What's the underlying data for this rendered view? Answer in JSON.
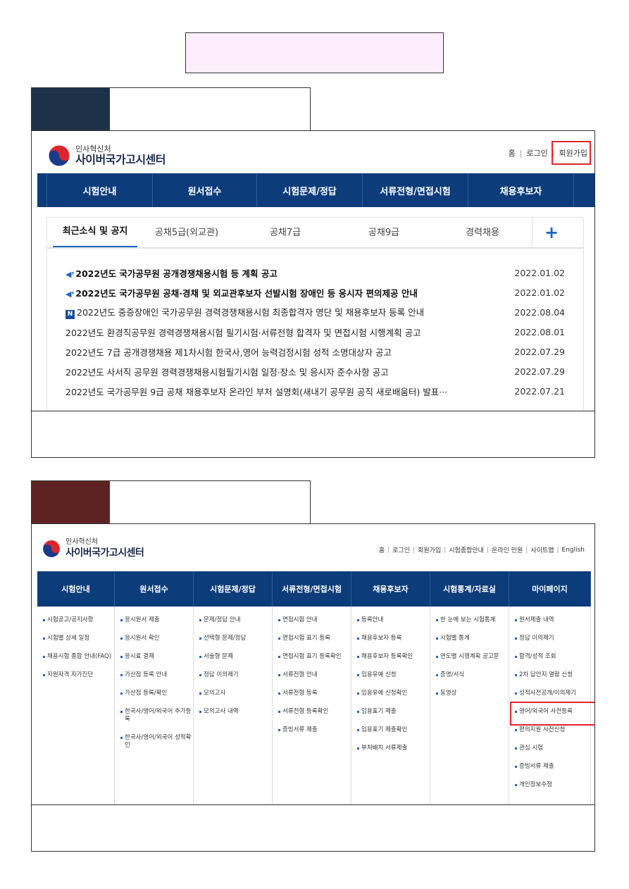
{
  "title_box": {
    "text": ""
  },
  "steps": [
    {
      "color": "#1d3249",
      "label": "",
      "caption": ""
    },
    {
      "color": "#5e2222",
      "label": "",
      "caption": ""
    }
  ],
  "site": {
    "logo_small": "인사혁신처",
    "logo_big": "사이버국가고시센터"
  },
  "screen1": {
    "util": [
      "홈",
      "로그인",
      "회원가입"
    ],
    "nav": [
      "시험안내",
      "원서접수",
      "시험문제/정답",
      "서류전형/면접시험",
      "채용후보자"
    ],
    "tabs": [
      "최근소식 및 공지",
      "공채5급(외교관)",
      "공채7급",
      "공채9급",
      "경력채용"
    ],
    "plus": "+",
    "news": [
      {
        "title": "2022년도 국가공무원 공개경쟁채용시험 등 계획 공고",
        "date": "2022.01.02",
        "icon": "speaker",
        "bold": true
      },
      {
        "title": "2022년도 국가공무원 공채·경채 및 외교관후보자 선발시험 장애인 등 응시자 편의제공 안내",
        "date": "2022.01.02",
        "icon": "speaker",
        "bold": true
      },
      {
        "title": "2022년도 중증장애인 국가공무원 경력경쟁채용시험 최종합격자 명단 및 채용후보자 등록 안내",
        "date": "2022.08.04",
        "icon": "new",
        "bold": false
      },
      {
        "title": "2022년도 환경직공무원 경력경쟁채용시험 필기시험·서류전형 합격자 및 면접시험 시행계획 공고",
        "date": "2022.08.01",
        "icon": "",
        "bold": false
      },
      {
        "title": "2022년도 7급 공개경쟁채용 제1차시험 한국사,영어 능력검정시험 성적 소명대상자 공고",
        "date": "2022.07.29",
        "icon": "",
        "bold": false
      },
      {
        "title": "2022년도 사서직 공무원 경력경쟁채용시험필기시험 일정·장소 및 응시자 준수사항 공고",
        "date": "2022.07.29",
        "icon": "",
        "bold": false
      },
      {
        "title": "2022년도 국가공무원 9급 공채 채용후보자 온라인 부처 설명회(새내기 공무원 공직 새로배움터) 발표···",
        "date": "2022.07.21",
        "icon": "",
        "bold": false
      }
    ],
    "new_badge": "N"
  },
  "screen2": {
    "util": [
      "홈",
      "로그인",
      "회원가입",
      "시험종합안내",
      "온라인 민원",
      "사이트맵",
      "English"
    ],
    "nav": [
      "시험안내",
      "원서접수",
      "시험문제/정답",
      "서류전형/면접시험",
      "채용후보자",
      "시험통계/자료실",
      "마이페이지"
    ],
    "columns": [
      [
        "시험공고/공지사항",
        "시험별 상세 일정",
        "채용시험 종합 안내(FAQ)",
        "지원자격 자가진단"
      ],
      [
        "응시원서 제출",
        "응시원서 확인",
        "응시료 결제",
        "가산점 등록 안내",
        "가산점 등록/확인",
        "한국사/영어/외국어 추가등록",
        "한국사/영어/외국어 성적확인"
      ],
      [
        "문제/정답 안내",
        "선택형 문제/정답",
        "서술형 문제",
        "정답 이의제기",
        "모의고사",
        "모의고사 내역"
      ],
      [
        "면접시험 안내",
        "면접시험 표기 등록",
        "면접시험 표기 등록확인",
        "서류전형 안내",
        "서류전형 등록",
        "서류전형 등록확인",
        "증빙서류 제출"
      ],
      [
        "등록안내",
        "채용후보자 등록",
        "채용후보자 등록확인",
        "임용유예 신청",
        "임용유예 신청확인",
        "임용표기 제출",
        "임용표기 제출확인",
        "부처배치 서류제출"
      ],
      [
        "한 눈에 보는 시험통계",
        "시험별 통계",
        "연도별 시행계획 공고문",
        "증명/서식",
        "동영상"
      ],
      [
        "원서제출 내역",
        "정답 이의제기",
        "합격/성적 조회",
        "2차 답안지 열람 신청",
        "성적사전공개/이의제기",
        "영어/외국어 사전등록",
        "편의지원 사전신청",
        "관심 시험",
        "증빙서류 제출",
        "개인정보수정"
      ]
    ]
  }
}
